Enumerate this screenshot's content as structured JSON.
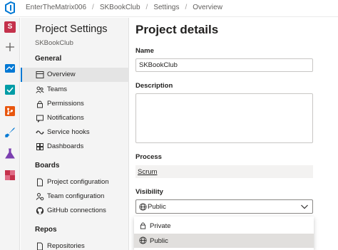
{
  "topbar": {
    "breadcrumbs": [
      "EnterTheMatrix006",
      "SKBookClub",
      "Settings",
      "Overview"
    ]
  },
  "rail": {
    "avatar_letter": "S",
    "avatar_color": "#c4314b"
  },
  "nav": {
    "title": "Project Settings",
    "project": "SKBookClub",
    "sections": [
      {
        "header": "General",
        "items": [
          {
            "label": "Overview",
            "icon": "overview-icon",
            "selected": true
          },
          {
            "label": "Teams",
            "icon": "teams-icon"
          },
          {
            "label": "Permissions",
            "icon": "lock-icon"
          },
          {
            "label": "Notifications",
            "icon": "notification-icon"
          },
          {
            "label": "Service hooks",
            "icon": "service-hooks-icon"
          },
          {
            "label": "Dashboards",
            "icon": "dashboard-icon"
          }
        ]
      },
      {
        "header": "Boards",
        "items": [
          {
            "label": "Project configuration",
            "icon": "document-icon"
          },
          {
            "label": "Team configuration",
            "icon": "team-config-icon"
          },
          {
            "label": "GitHub connections",
            "icon": "github-icon"
          }
        ]
      },
      {
        "header": "Repos",
        "items": [
          {
            "label": "Repositories",
            "icon": "document-icon"
          }
        ]
      }
    ]
  },
  "main": {
    "title": "Project details",
    "name_label": "Name",
    "name_value": "SKBookClub",
    "description_label": "Description",
    "process_label": "Process",
    "process_value": "Scrum",
    "visibility_label": "Visibility",
    "visibility_value": "Public",
    "visibility_options": [
      {
        "label": "Private",
        "icon": "lock-icon"
      },
      {
        "label": "Public",
        "icon": "globe-icon",
        "selected": true
      }
    ]
  },
  "colors": {
    "accent": "#0078d4",
    "nav_background": "#f4f4f4",
    "selected_background": "#e4e4e4"
  }
}
